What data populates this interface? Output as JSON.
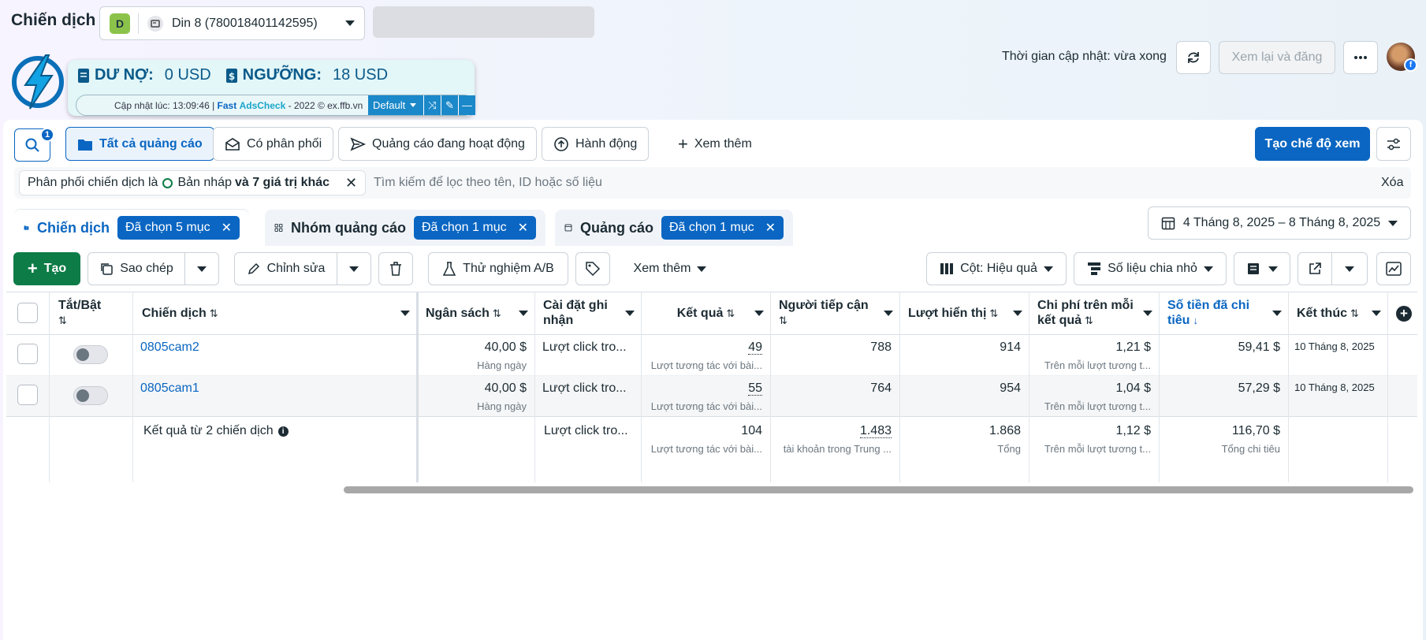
{
  "header": {
    "title": "Chiến dịch",
    "account_badge": "D",
    "account_name": "Din 8 (780018401142595)",
    "update_text": "Thời gian cập nhật: vừa xong",
    "review_publish": "Xem lại và đăng"
  },
  "extension": {
    "debt_label": "DƯ NỢ:",
    "debt_value": "0 USD",
    "threshold_label": "NGƯỠNG:",
    "threshold_value": "18 USD",
    "updated_prefix": "Cập nhật lúc: 13:09:46 | ",
    "fast": "Fast",
    "adscheck": "AdsCheck",
    "suffix": " - 2022 © ex.ffb.vn",
    "preset": "Default"
  },
  "filters": {
    "search_badge": "1",
    "tabs": [
      "Tất cả quảng cáo",
      "Có phân phối",
      "Quảng cáo đang hoạt động",
      "Hành động",
      "Xem thêm"
    ],
    "create_view": "Tạo chế độ xem",
    "chip_prefix": "Phân phối chiến dịch là",
    "chip_value": "Bản nháp",
    "chip_more": "và 7 giá trị khác",
    "search_placeholder": "Tìm kiếm để lọc theo tên, ID hoặc số liệu",
    "clear": "Xóa"
  },
  "levels": [
    {
      "label": "Chiến dịch",
      "tag": "Đã chọn 5 mục"
    },
    {
      "label": "Nhóm quảng cáo",
      "tag": "Đã chọn 1 mục"
    },
    {
      "label": "Quảng cáo",
      "tag": "Đã chọn 1 mục"
    }
  ],
  "date_range": "4 Tháng 8, 2025 – 8 Tháng 8, 2025",
  "toolbar": {
    "create": "Tạo",
    "duplicate": "Sao chép",
    "edit": "Chỉnh sửa",
    "ab_test": "Thử nghiệm A/B",
    "more": "Xem thêm",
    "columns": "Cột: Hiệu quả",
    "breakdown": "Số liệu chia nhỏ"
  },
  "table": {
    "headers": {
      "toggle": "Tắt/Bật",
      "campaign": "Chiến dịch",
      "budget": "Ngân sách",
      "attribution_1": "Cài đặt ghi",
      "attribution_2": "nhận",
      "results": "Kết quả",
      "reach": "Người tiếp cận",
      "impressions": "Lượt hiển thị",
      "cpr_1": "Chi phí trên mỗi",
      "cpr_2": "kết quả",
      "spent_1": "Số tiền đã chi",
      "spent_2": "tiêu",
      "ends": "Kết thúc"
    },
    "rows": [
      {
        "name": "0805cam2",
        "budget": "40,00 $",
        "budget_sub": "Hàng ngày",
        "attribution": "Lượt click tro...",
        "results": "49",
        "results_sub": "Lượt tương tác với bài...",
        "reach": "788",
        "impressions": "914",
        "cpr": "1,21 $",
        "cpr_sub": "Trên mỗi lượt tương t...",
        "spent": "59,41 $",
        "ends": "10 Tháng 8, 2025"
      },
      {
        "name": "0805cam1",
        "budget": "40,00 $",
        "budget_sub": "Hàng ngày",
        "attribution": "Lượt click tro...",
        "results": "55",
        "results_sub": "Lượt tương tác với bài...",
        "reach": "764",
        "impressions": "954",
        "cpr": "1,04 $",
        "cpr_sub": "Trên mỗi lượt tương t...",
        "spent": "57,29 $",
        "ends": "10 Tháng 8, 2025"
      }
    ],
    "summary": {
      "label": "Kết quả từ 2 chiến dịch",
      "attribution": "Lượt click tro...",
      "results": "104",
      "results_sub": "Lượt tương tác với bài...",
      "reach": "1.483",
      "reach_sub": "tài khoản trong Trung ...",
      "impressions": "1.868",
      "impressions_sub": "Tổng",
      "cpr": "1,12 $",
      "cpr_sub": "Trên mỗi lượt tương t...",
      "spent": "116,70 $",
      "spent_sub": "Tổng chi tiêu"
    }
  },
  "colors": {
    "accent": "#0a66c2",
    "create": "#0d7c47"
  }
}
